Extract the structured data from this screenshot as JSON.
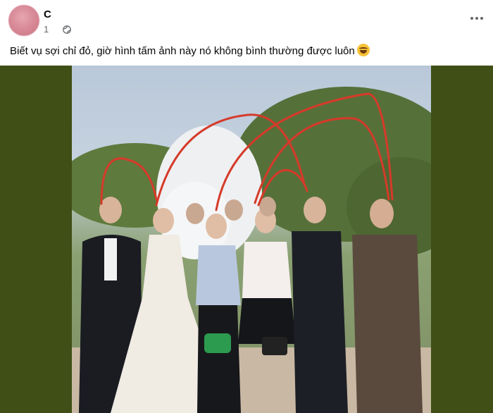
{
  "post": {
    "author": "C",
    "time": "1",
    "privacy_icon": "globe-icon",
    "more_icon": "more-options-icon",
    "caption": "Biết vụ sợi chỉ đỏ, giờ hình tấm ảnh này nó không bình thường được luôn",
    "caption_emoji": "rolling-on-floor-laughing-emoji"
  },
  "colors": {
    "media_background": "#3f4f16",
    "thread": "#d63a2a",
    "meta_text": "#65676b"
  }
}
